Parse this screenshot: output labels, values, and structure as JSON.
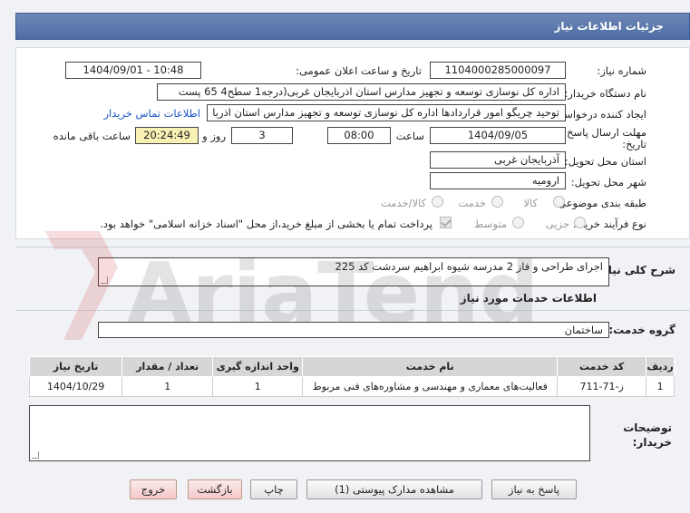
{
  "header": {
    "title": "جزئیات اطلاعات نیاز"
  },
  "fields": {
    "need_number_label": "شماره نیاز:",
    "need_number": "1104000285000097",
    "announce_label": "تاریخ و ساعت اعلان عمومی:",
    "announce_value": "1404/09/01 - 10:48",
    "buyer_org_label": "نام دستگاه خریدار:",
    "buyer_org": "اداره کل نوسازی   توسعه و تجهیز مدارس استان اذربایجان غربی(درجه1  سطح4  65 پست",
    "creator_label": "ایجاد کننده درخواست:",
    "creator": "توحید چریگو امور قراردادها اداره کل نوسازی   توسعه و تجهیز مدارس استان اذربا",
    "contact_link": "اطلاعات تماس خریدار",
    "deadline_label_1": "مهلت ارسال پاسخ: تا",
    "deadline_label_2": "تاریخ:",
    "deadline_date": "1404/09/05",
    "time_label": "ساعت",
    "deadline_time": "08:00",
    "days_value": "3",
    "days_label": "روز و",
    "remaining_time": "20:24:49",
    "remaining_label": "ساعت باقی مانده",
    "province_label": "استان محل تحویل:",
    "province": "آذربایجان غربی",
    "city_label": "شهر محل تحویل:",
    "city": "ارومیه",
    "category_label": "طبقه بندی موضوعی:",
    "category_options": [
      "کالا",
      "خدمت",
      "کالا/خدمت"
    ],
    "process_label": "نوع فرآیند خرید :",
    "process_options": [
      "جزیی",
      "متوسط"
    ],
    "payment_note": "پرداخت تمام یا بخشی از مبلغ خرید،از محل \"اسناد خزانه اسلامی\" خواهد بود."
  },
  "description": {
    "label": "شرح کلی نیاز:",
    "value": "اجرای طراحی و فاز 2 مدرسه شیوه ابراهیم سردشت کد 225"
  },
  "services_title": "اطلاعات خدمات مورد نیاز",
  "service_group": {
    "label": "گروه خدمت:",
    "value": "ساختمان"
  },
  "table": {
    "headers": [
      "ردیف",
      "کد خدمت",
      "نام خدمت",
      "واحد اندازه گیری",
      "تعداد / مقدار",
      "تاریخ نیاز"
    ],
    "rows": [
      [
        "1",
        "ز-71-711",
        "فعالیت‌های معماری و مهندسی و مشاوره‌های فنی مربوط",
        "1",
        "1",
        "1404/10/29"
      ]
    ]
  },
  "buyer_notes": {
    "label_1": "توضیحات",
    "label_2": "خریدار:",
    "value": ""
  },
  "buttons": {
    "reply": "پاسخ به نیاز",
    "attachments": "مشاهده مدارک پیوستی (1)",
    "print": "چاپ",
    "back": "بازگشت",
    "exit": "خروج"
  },
  "watermark": "AriaTender.net"
}
